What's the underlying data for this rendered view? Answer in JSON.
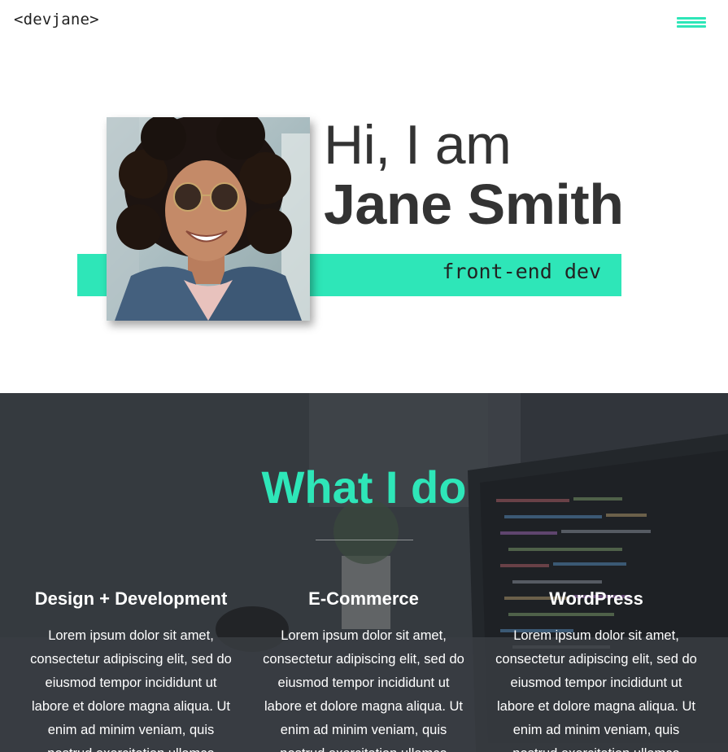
{
  "theme": {
    "accent": "#2ee6b8",
    "text": "#333333",
    "overlay": "#2a2d33"
  },
  "header": {
    "logo": "<devjane>",
    "menu_icon": "hamburger-icon"
  },
  "hero": {
    "greeting": "Hi, I am",
    "name": "Jane Smith",
    "role": "front-end dev",
    "portrait": "profile-photo"
  },
  "services": {
    "title": "What I do",
    "items": [
      {
        "title": "Design + Development",
        "text": "Lorem ipsum dolor sit amet, consectetur adipiscing elit, sed do eiusmod tempor incididunt ut labore et dolore magna aliqua. Ut enim ad minim veniam, quis nostrud exercitation ullamco"
      },
      {
        "title": "E-Commerce",
        "text": "Lorem ipsum dolor sit amet, consectetur adipiscing elit, sed do eiusmod tempor incididunt ut labore et dolore magna aliqua. Ut enim ad minim veniam, quis nostrud exercitation ullamco"
      },
      {
        "title": "WordPress",
        "text": "Lorem ipsum dolor sit amet, consectetur adipiscing elit, sed do eiusmod tempor incididunt ut labore et dolore magna aliqua. Ut enim ad minim veniam, quis nostrud exercitation ullamco"
      }
    ]
  }
}
